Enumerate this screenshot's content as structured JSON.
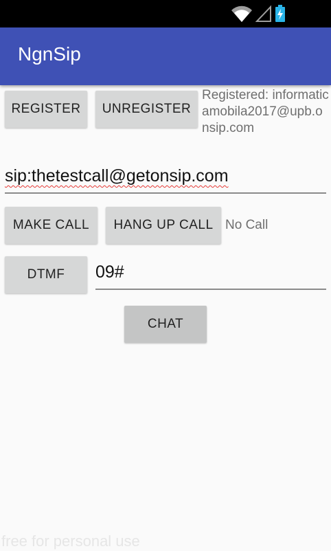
{
  "status_bar": {
    "icons": [
      "wifi-icon",
      "cell-signal-icon",
      "battery-charging-icon"
    ]
  },
  "app_bar": {
    "title": "NgnSip"
  },
  "registration": {
    "register_label": "REGISTER",
    "unregister_label": "UNREGISTER",
    "status": "Registered: informaticamobila2017@upb.onsip.com"
  },
  "call": {
    "sip_address": "sip:thetestcall@getonsip.com",
    "make_call_label": "MAKE CALL",
    "hang_up_label": "HANG UP CALL",
    "status": "No Call"
  },
  "dtmf": {
    "button_label": "DTMF",
    "value": "09#"
  },
  "chat": {
    "button_label": "CHAT"
  },
  "watermark": "free for personal use",
  "colors": {
    "app_bar": "#3f51b5",
    "button": "#d6d7d7",
    "spell_underline": "#e53935"
  }
}
